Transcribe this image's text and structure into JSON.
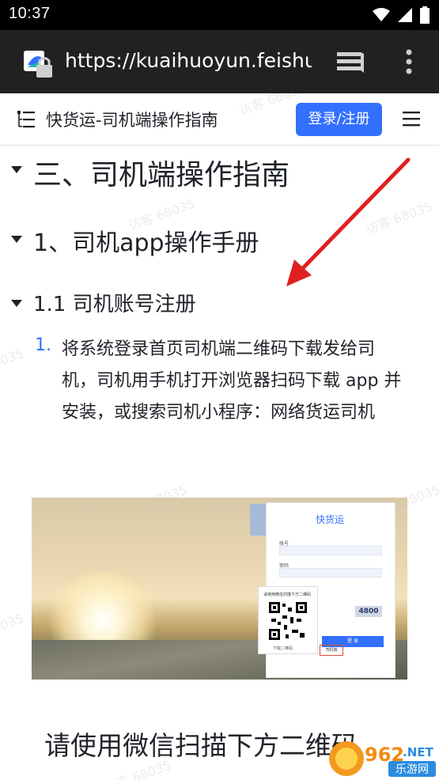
{
  "status_bar": {
    "time": "10:37"
  },
  "browser": {
    "url": "https://kuaihuoyun.feishu"
  },
  "header": {
    "title": "快货运-司机端操作指南",
    "login_label": "登录/注册"
  },
  "content": {
    "h1": "三、司机端操作指南",
    "h2": "1、司机app操作手册",
    "h3": "1.1  司机账号注册",
    "list_item_1": {
      "number": "1.",
      "text": "将系统登录首页司机端二维码下载发给司机，司机用手机打开浏览器扫码下载 app 并安装，或搜索司机小程序：网络货运司机"
    },
    "image": {
      "card_title": "快货运",
      "captcha": "4800",
      "submit_label": "登 录",
      "qr_caption": "请使用微信扫描下方二维码",
      "qr_download": "下载二维码",
      "driver_tag": "司机端"
    },
    "bottom_text": "请使用微信扫描下方二维码"
  },
  "watermarks": [
    "访客 68035",
    "访客 68035",
    "访客 68035",
    "访客 68035",
    "访客 68035",
    "访客 68035"
  ],
  "corner_logo": {
    "text": "962.NET",
    "subtext": "乐游网"
  },
  "colors": {
    "accent": "#3370ff",
    "arrow": "#e02020",
    "status_bar": "#000000",
    "browser_bar": "#212121"
  }
}
